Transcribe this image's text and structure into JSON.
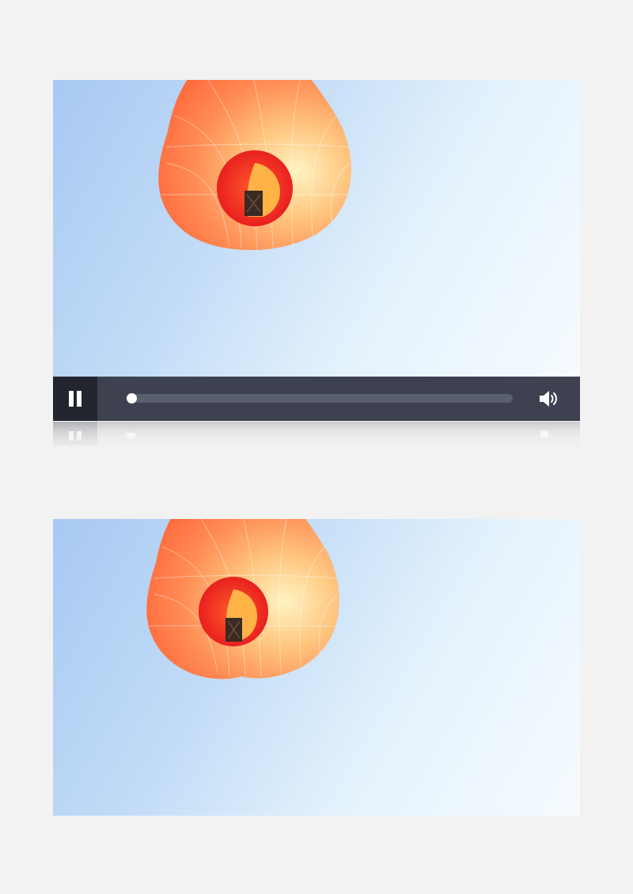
{
  "players": [
    {
      "scene": "hot-air-balloon-from-below",
      "controls": {
        "state": "playing",
        "play_pause_icon": "pause-icon",
        "progress_fraction": 0.0,
        "volume_icon": "volume-high-icon"
      }
    },
    {
      "scene": "hot-air-balloon-from-below",
      "controls": null
    }
  ],
  "colors": {
    "control_bar": "#3d4150",
    "play_button_bg": "#22252e",
    "progress_track": "#5a5f70",
    "progress_thumb": "#ffffff",
    "balloon_orange": "#ff7a45",
    "balloon_inner_red": "#f02a23"
  }
}
